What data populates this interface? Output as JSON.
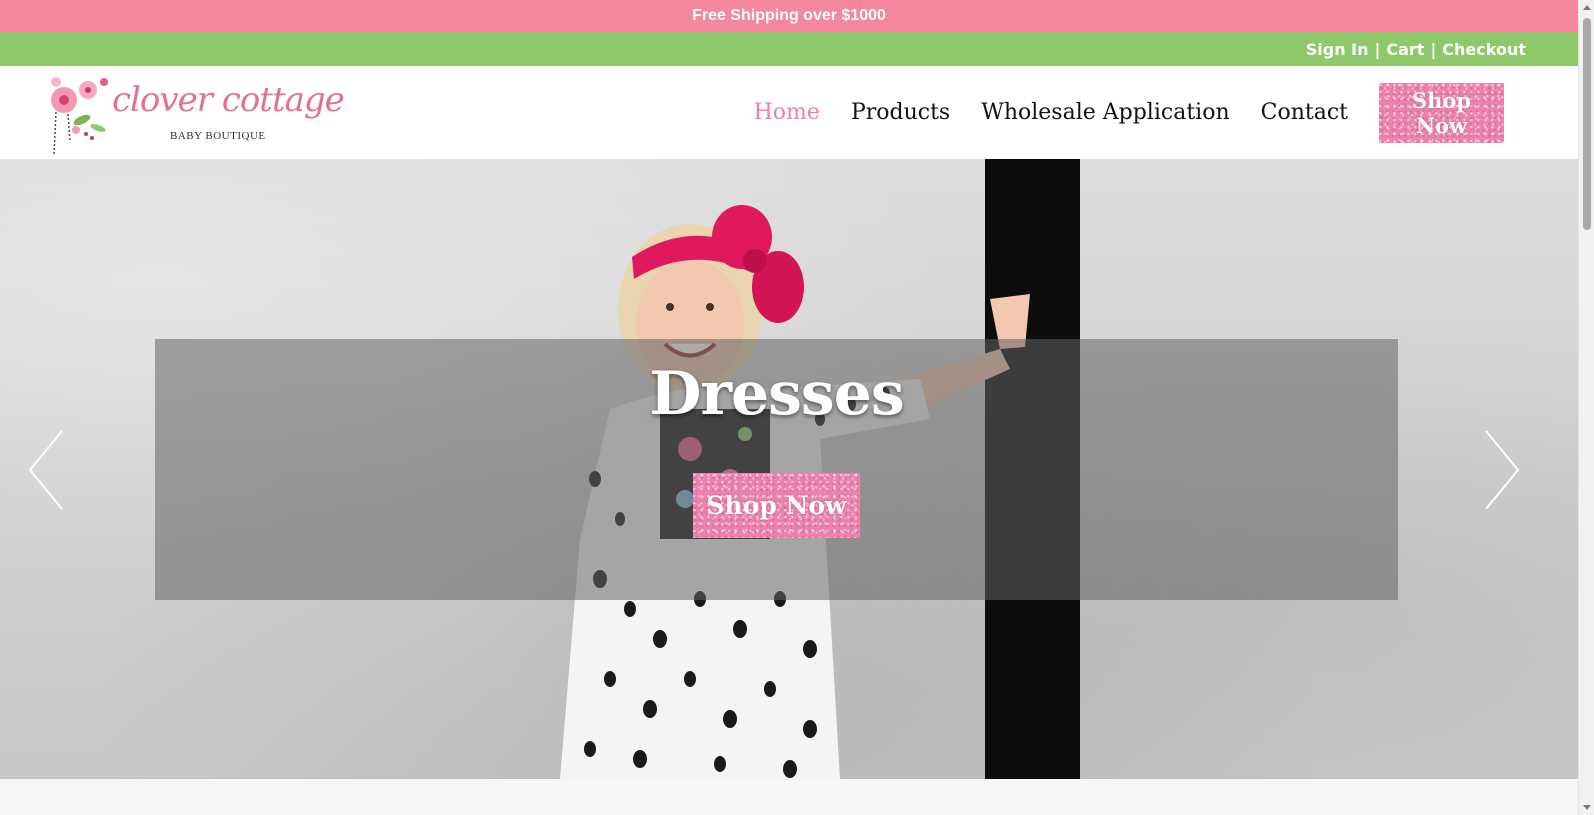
{
  "promo": {
    "text": "Free Shipping over $1000"
  },
  "account": {
    "sign_in": "Sign In",
    "cart": "Cart",
    "checkout": "Checkout",
    "separator": "|"
  },
  "logo": {
    "title": "clover cottage",
    "subtitle": "BABY BOUTIQUE"
  },
  "nav": {
    "items": [
      {
        "label": "Home",
        "active": true
      },
      {
        "label": "Products",
        "active": false
      },
      {
        "label": "Wholesale Application",
        "active": false
      },
      {
        "label": "Contact",
        "active": false
      }
    ],
    "shop_button": "Shop Now"
  },
  "hero": {
    "title": "Dresses",
    "shop_button": "Shop Now",
    "prev_icon": "chevron-left-icon",
    "next_icon": "chevron-right-icon"
  },
  "colors": {
    "promo_bg": "#f4879b",
    "account_bg": "#8ec86a",
    "nav_active": "#f17fa0",
    "button_pink": "#eb82ad"
  }
}
